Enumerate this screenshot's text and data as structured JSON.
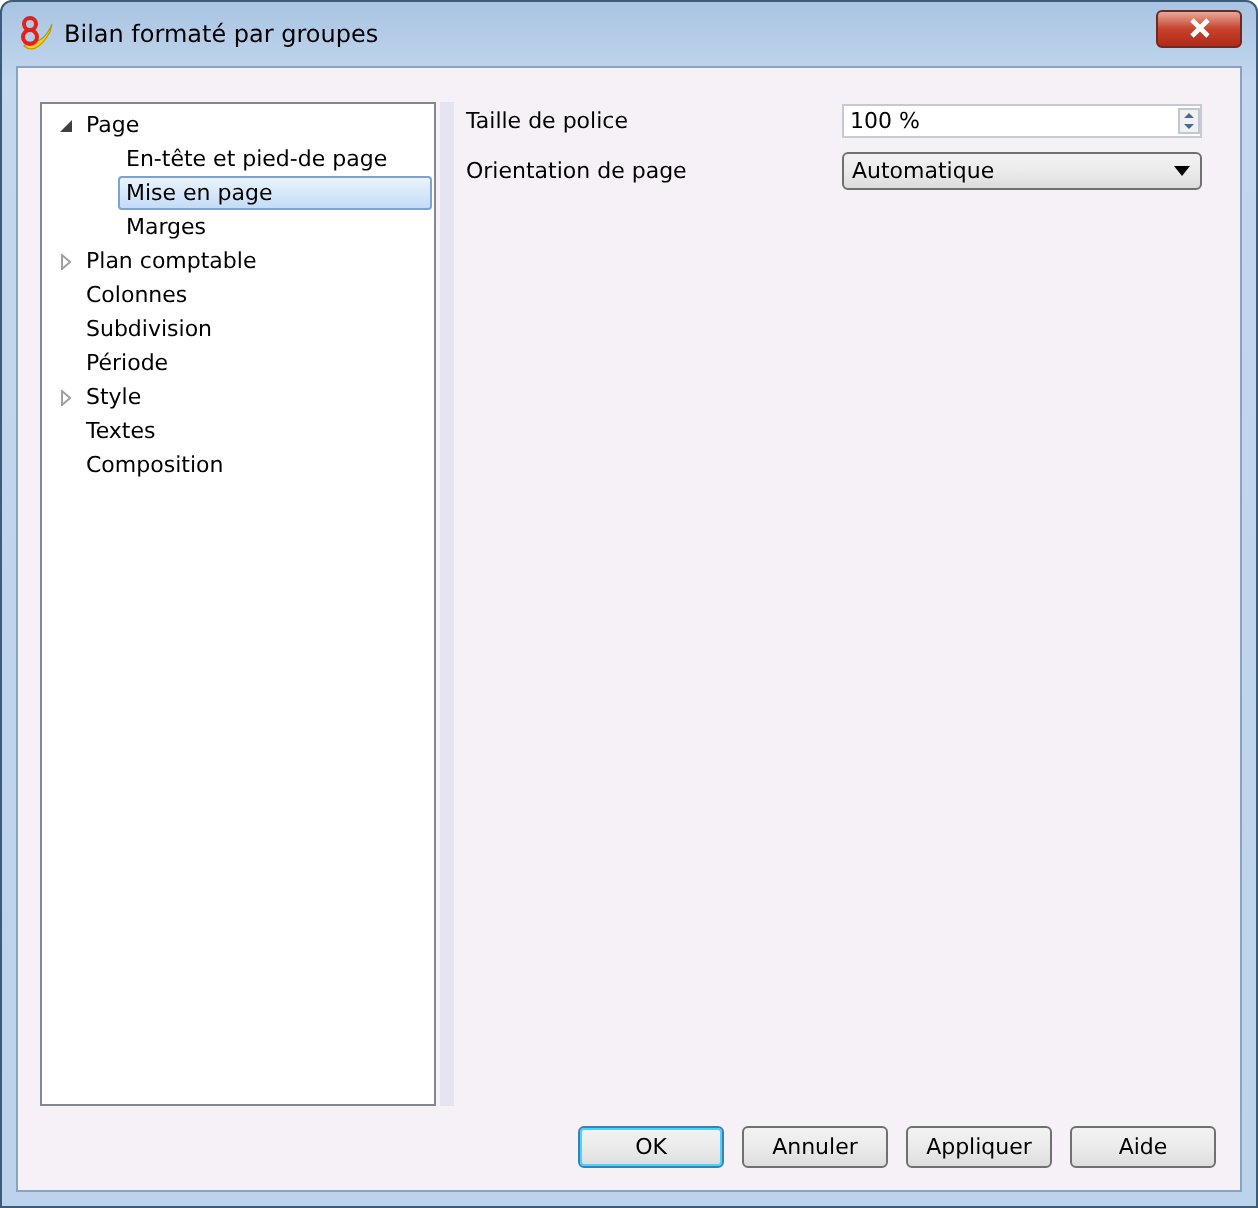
{
  "window": {
    "title": "Bilan formaté par groupes"
  },
  "tree": [
    {
      "label": "Page",
      "expanded": true,
      "selected": false,
      "children": [
        {
          "label": "En-tête et pied-de page",
          "selected": false
        },
        {
          "label": "Mise en page",
          "selected": true
        },
        {
          "label": "Marges",
          "selected": false
        }
      ]
    },
    {
      "label": "Plan comptable",
      "expanded": false,
      "selected": false
    },
    {
      "label": "Colonnes",
      "selected": false
    },
    {
      "label": "Subdivision",
      "selected": false
    },
    {
      "label": "Période",
      "selected": false
    },
    {
      "label": "Style",
      "expanded": false,
      "selected": false
    },
    {
      "label": "Textes",
      "selected": false
    },
    {
      "label": "Composition",
      "selected": false
    }
  ],
  "settings": [
    {
      "label": "Taille de police",
      "kind": "spin",
      "value": "100 %"
    },
    {
      "label": "Orientation de page",
      "kind": "combo",
      "value": "Automatique"
    }
  ],
  "buttons": [
    {
      "label": "OK",
      "default": true
    },
    {
      "label": "Annuler",
      "default": false
    },
    {
      "label": "Appliquer",
      "default": false
    },
    {
      "label": "Aide",
      "default": false
    }
  ]
}
